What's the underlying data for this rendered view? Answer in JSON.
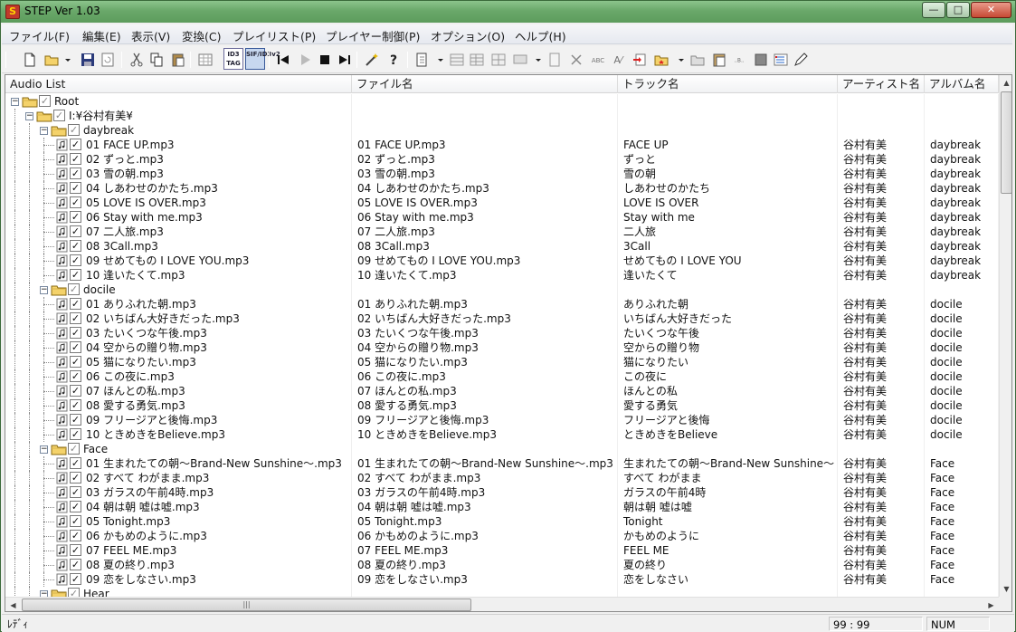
{
  "window": {
    "title": "STEP Ver 1.03",
    "min_glyph": "—",
    "max_glyph": "□",
    "close_glyph": "✕"
  },
  "menu": [
    "ファイル(F)",
    "編集(E)",
    "表示(V)",
    "変換(C)",
    "プレイリスト(P)",
    "プレイヤー制御(P)",
    "オプション(O)",
    "ヘルプ(H)"
  ],
  "toolbar": {
    "id3_tag_label": "ID3 TAG",
    "sif_label": "SIF/ID3v2"
  },
  "list": {
    "columns": [
      "Audio List",
      "ファイル名",
      "トラック名",
      "アーティスト名",
      "アルバム名"
    ],
    "rows": [
      {
        "level": 0,
        "type": "folder",
        "name": "Root",
        "file": "",
        "track": "",
        "artist": "",
        "album": ""
      },
      {
        "level": 1,
        "type": "folder",
        "name": "I:¥谷村有美¥",
        "file": "",
        "track": "",
        "artist": "",
        "album": ""
      },
      {
        "level": 2,
        "type": "folder",
        "name": "daybreak",
        "file": "",
        "track": "",
        "artist": "",
        "album": ""
      },
      {
        "level": 3,
        "type": "file",
        "name": "01 FACE UP.mp3",
        "file": "01 FACE UP.mp3",
        "track": "FACE UP",
        "artist": "谷村有美",
        "album": "daybreak"
      },
      {
        "level": 3,
        "type": "file",
        "name": "02 ずっと.mp3",
        "file": "02 ずっと.mp3",
        "track": "ずっと",
        "artist": "谷村有美",
        "album": "daybreak"
      },
      {
        "level": 3,
        "type": "file",
        "name": "03 雪の朝.mp3",
        "file": "03 雪の朝.mp3",
        "track": "雪の朝",
        "artist": "谷村有美",
        "album": "daybreak"
      },
      {
        "level": 3,
        "type": "file",
        "name": "04 しあわせのかたち.mp3",
        "file": "04 しあわせのかたち.mp3",
        "track": "しあわせのかたち",
        "artist": "谷村有美",
        "album": "daybreak"
      },
      {
        "level": 3,
        "type": "file",
        "name": "05 LOVE IS OVER.mp3",
        "file": "05 LOVE IS OVER.mp3",
        "track": "LOVE IS OVER",
        "artist": "谷村有美",
        "album": "daybreak"
      },
      {
        "level": 3,
        "type": "file",
        "name": "06 Stay with me.mp3",
        "file": "06 Stay with me.mp3",
        "track": "Stay with me",
        "artist": "谷村有美",
        "album": "daybreak"
      },
      {
        "level": 3,
        "type": "file",
        "name": "07 二人旅.mp3",
        "file": "07 二人旅.mp3",
        "track": "二人旅",
        "artist": "谷村有美",
        "album": "daybreak"
      },
      {
        "level": 3,
        "type": "file",
        "name": "08 3Call.mp3",
        "file": "08 3Call.mp3",
        "track": "3Call",
        "artist": "谷村有美",
        "album": "daybreak"
      },
      {
        "level": 3,
        "type": "file",
        "name": "09 せめてもの I LOVE YOU.mp3",
        "file": "09 せめてもの I LOVE YOU.mp3",
        "track": "せめてもの I LOVE YOU",
        "artist": "谷村有美",
        "album": "daybreak"
      },
      {
        "level": 3,
        "type": "file",
        "name": "10 逢いたくて.mp3",
        "file": "10 逢いたくて.mp3",
        "track": "逢いたくて",
        "artist": "谷村有美",
        "album": "daybreak"
      },
      {
        "level": 2,
        "type": "folder",
        "name": "docile",
        "file": "",
        "track": "",
        "artist": "",
        "album": ""
      },
      {
        "level": 3,
        "type": "file",
        "name": "01 ありふれた朝.mp3",
        "file": "01 ありふれた朝.mp3",
        "track": "ありふれた朝",
        "artist": "谷村有美",
        "album": "docile"
      },
      {
        "level": 3,
        "type": "file",
        "name": "02 いちばん大好きだった.mp3",
        "file": "02 いちばん大好きだった.mp3",
        "track": "いちばん大好きだった",
        "artist": "谷村有美",
        "album": "docile"
      },
      {
        "level": 3,
        "type": "file",
        "name": "03 たいくつな午後.mp3",
        "file": "03 たいくつな午後.mp3",
        "track": "たいくつな午後",
        "artist": "谷村有美",
        "album": "docile"
      },
      {
        "level": 3,
        "type": "file",
        "name": "04 空からの贈り物.mp3",
        "file": "04 空からの贈り物.mp3",
        "track": "空からの贈り物",
        "artist": "谷村有美",
        "album": "docile"
      },
      {
        "level": 3,
        "type": "file",
        "name": "05 猫になりたい.mp3",
        "file": "05 猫になりたい.mp3",
        "track": "猫になりたい",
        "artist": "谷村有美",
        "album": "docile"
      },
      {
        "level": 3,
        "type": "file",
        "name": "06 この夜に.mp3",
        "file": "06 この夜に.mp3",
        "track": "この夜に",
        "artist": "谷村有美",
        "album": "docile"
      },
      {
        "level": 3,
        "type": "file",
        "name": "07 ほんとの私.mp3",
        "file": "07 ほんとの私.mp3",
        "track": "ほんとの私",
        "artist": "谷村有美",
        "album": "docile"
      },
      {
        "level": 3,
        "type": "file",
        "name": "08 愛する勇気.mp3",
        "file": "08 愛する勇気.mp3",
        "track": "愛する勇気",
        "artist": "谷村有美",
        "album": "docile"
      },
      {
        "level": 3,
        "type": "file",
        "name": "09 フリージアと後悔.mp3",
        "file": "09 フリージアと後悔.mp3",
        "track": "フリージアと後悔",
        "artist": "谷村有美",
        "album": "docile"
      },
      {
        "level": 3,
        "type": "file",
        "name": "10 ときめきをBelieve.mp3",
        "file": "10 ときめきをBelieve.mp3",
        "track": "ときめきをBelieve",
        "artist": "谷村有美",
        "album": "docile"
      },
      {
        "level": 2,
        "type": "folder",
        "name": "Face",
        "file": "",
        "track": "",
        "artist": "",
        "album": ""
      },
      {
        "level": 3,
        "type": "file",
        "name": "01 生まれたての朝～Brand-New Sunshine～.mp3",
        "file": "01 生まれたての朝～Brand-New Sunshine～.mp3",
        "track": "生まれたての朝～Brand-New Sunshine～",
        "artist": "谷村有美",
        "album": "Face"
      },
      {
        "level": 3,
        "type": "file",
        "name": "02 すべて わがまま.mp3",
        "file": "02 すべて わがまま.mp3",
        "track": "すべて わがまま",
        "artist": "谷村有美",
        "album": "Face"
      },
      {
        "level": 3,
        "type": "file",
        "name": "03 ガラスの午前4時.mp3",
        "file": "03 ガラスの午前4時.mp3",
        "track": "ガラスの午前4時",
        "artist": "谷村有美",
        "album": "Face"
      },
      {
        "level": 3,
        "type": "file",
        "name": "04 朝は朝 嘘は嘘.mp3",
        "file": "04 朝は朝 嘘は嘘.mp3",
        "track": "朝は朝 嘘は嘘",
        "artist": "谷村有美",
        "album": "Face"
      },
      {
        "level": 3,
        "type": "file",
        "name": "05 Tonight.mp3",
        "file": "05 Tonight.mp3",
        "track": "Tonight",
        "artist": "谷村有美",
        "album": "Face"
      },
      {
        "level": 3,
        "type": "file",
        "name": "06 かもめのように.mp3",
        "file": "06 かもめのように.mp3",
        "track": "かもめのように",
        "artist": "谷村有美",
        "album": "Face"
      },
      {
        "level": 3,
        "type": "file",
        "name": "07 FEEL ME.mp3",
        "file": "07 FEEL ME.mp3",
        "track": "FEEL ME",
        "artist": "谷村有美",
        "album": "Face"
      },
      {
        "level": 3,
        "type": "file",
        "name": "08 夏の終り.mp3",
        "file": "08 夏の終り.mp3",
        "track": "夏の終り",
        "artist": "谷村有美",
        "album": "Face"
      },
      {
        "level": 3,
        "type": "file",
        "name": "09 恋をしなさい.mp3",
        "file": "09 恋をしなさい.mp3",
        "track": "恋をしなさい",
        "artist": "谷村有美",
        "album": "Face"
      },
      {
        "level": 2,
        "type": "folder",
        "name": "Hear",
        "file": "",
        "track": "",
        "artist": "",
        "album": ""
      }
    ]
  },
  "statusbar": {
    "status": "ﾚﾃﾞｨ",
    "position": "99 : 99",
    "num": "NUM"
  }
}
